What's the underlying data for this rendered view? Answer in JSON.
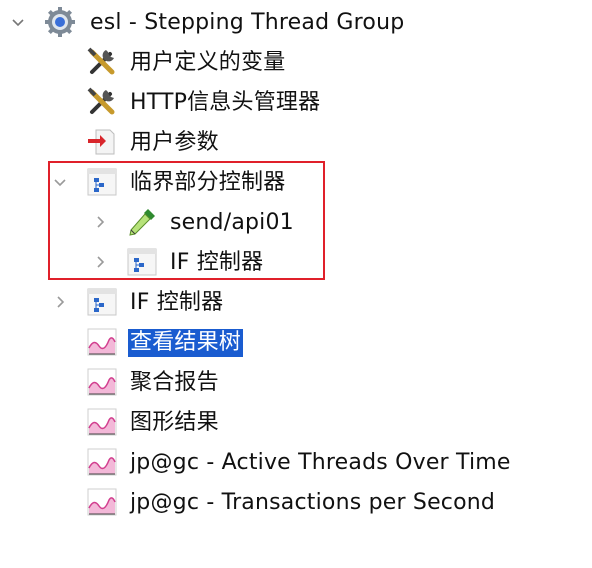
{
  "tree": {
    "root": {
      "label": "esl - Stepping Thread Group",
      "icon": "gear-icon",
      "expanded": true
    },
    "items": [
      {
        "label": "用户定义的变量",
        "icon": "wrench-screwdriver-icon"
      },
      {
        "label": "HTTP信息头管理器",
        "icon": "wrench-screwdriver-icon"
      },
      {
        "label": "用户参数",
        "icon": "preprocessor-arrow-icon"
      },
      {
        "label": "临界部分控制器",
        "icon": "controller-icon",
        "expanded": true,
        "children": [
          {
            "label": "send/api01",
            "icon": "sampler-pipette-icon",
            "expanded": false
          },
          {
            "label": "IF 控制器",
            "icon": "controller-icon",
            "expanded": false
          }
        ]
      },
      {
        "label": "IF 控制器",
        "icon": "controller-icon",
        "expanded": false
      },
      {
        "label": "查看结果树",
        "icon": "listener-graph-icon",
        "selected": true
      },
      {
        "label": "聚合报告",
        "icon": "listener-graph-icon"
      },
      {
        "label": "图形结果",
        "icon": "listener-graph-icon"
      },
      {
        "label": "jp@gc - Active Threads Over Time",
        "icon": "listener-graph-icon"
      },
      {
        "label": "jp@gc - Transactions per Second",
        "icon": "listener-graph-icon"
      }
    ]
  },
  "colors": {
    "selection": "#1a5cd0",
    "highlight_border": "#e0202a"
  }
}
